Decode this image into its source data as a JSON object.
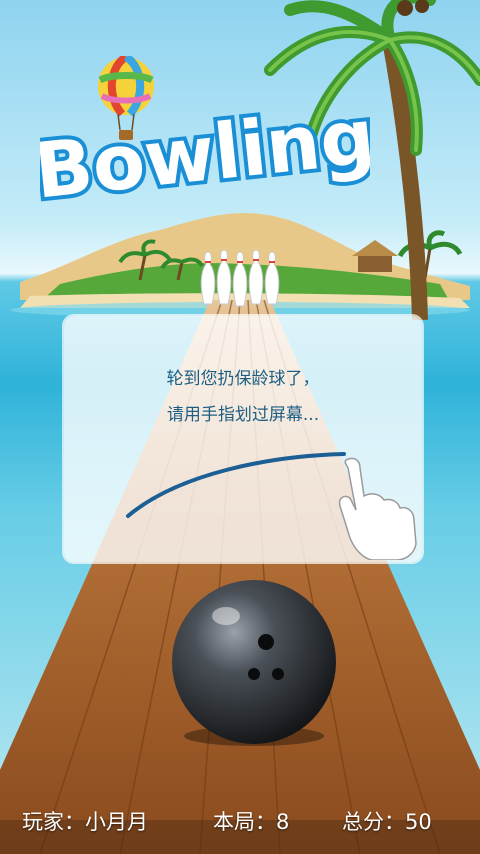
{
  "title": "Bowling",
  "prompt": {
    "line1": "轮到您扔保龄球了，",
    "line2": "请用手指划过屏幕..."
  },
  "hud": {
    "player_label": "玩家",
    "player_name": "小月月",
    "round_label": "本局",
    "round_score": "8",
    "total_label": "总分",
    "total_score": "50",
    "separator": "："
  },
  "colors": {
    "title_fill": "#ffffff",
    "title_outline": "#1a8fd6",
    "prompt_text": "#1d5f84",
    "hud_text": "#ffffff",
    "lane_wood": "#a9642a"
  },
  "icons": {
    "balloon": "hot-air-balloon-icon",
    "hand": "swipe-hand-icon",
    "ball": "bowling-ball-icon",
    "pins": "bowling-pins-icon"
  }
}
